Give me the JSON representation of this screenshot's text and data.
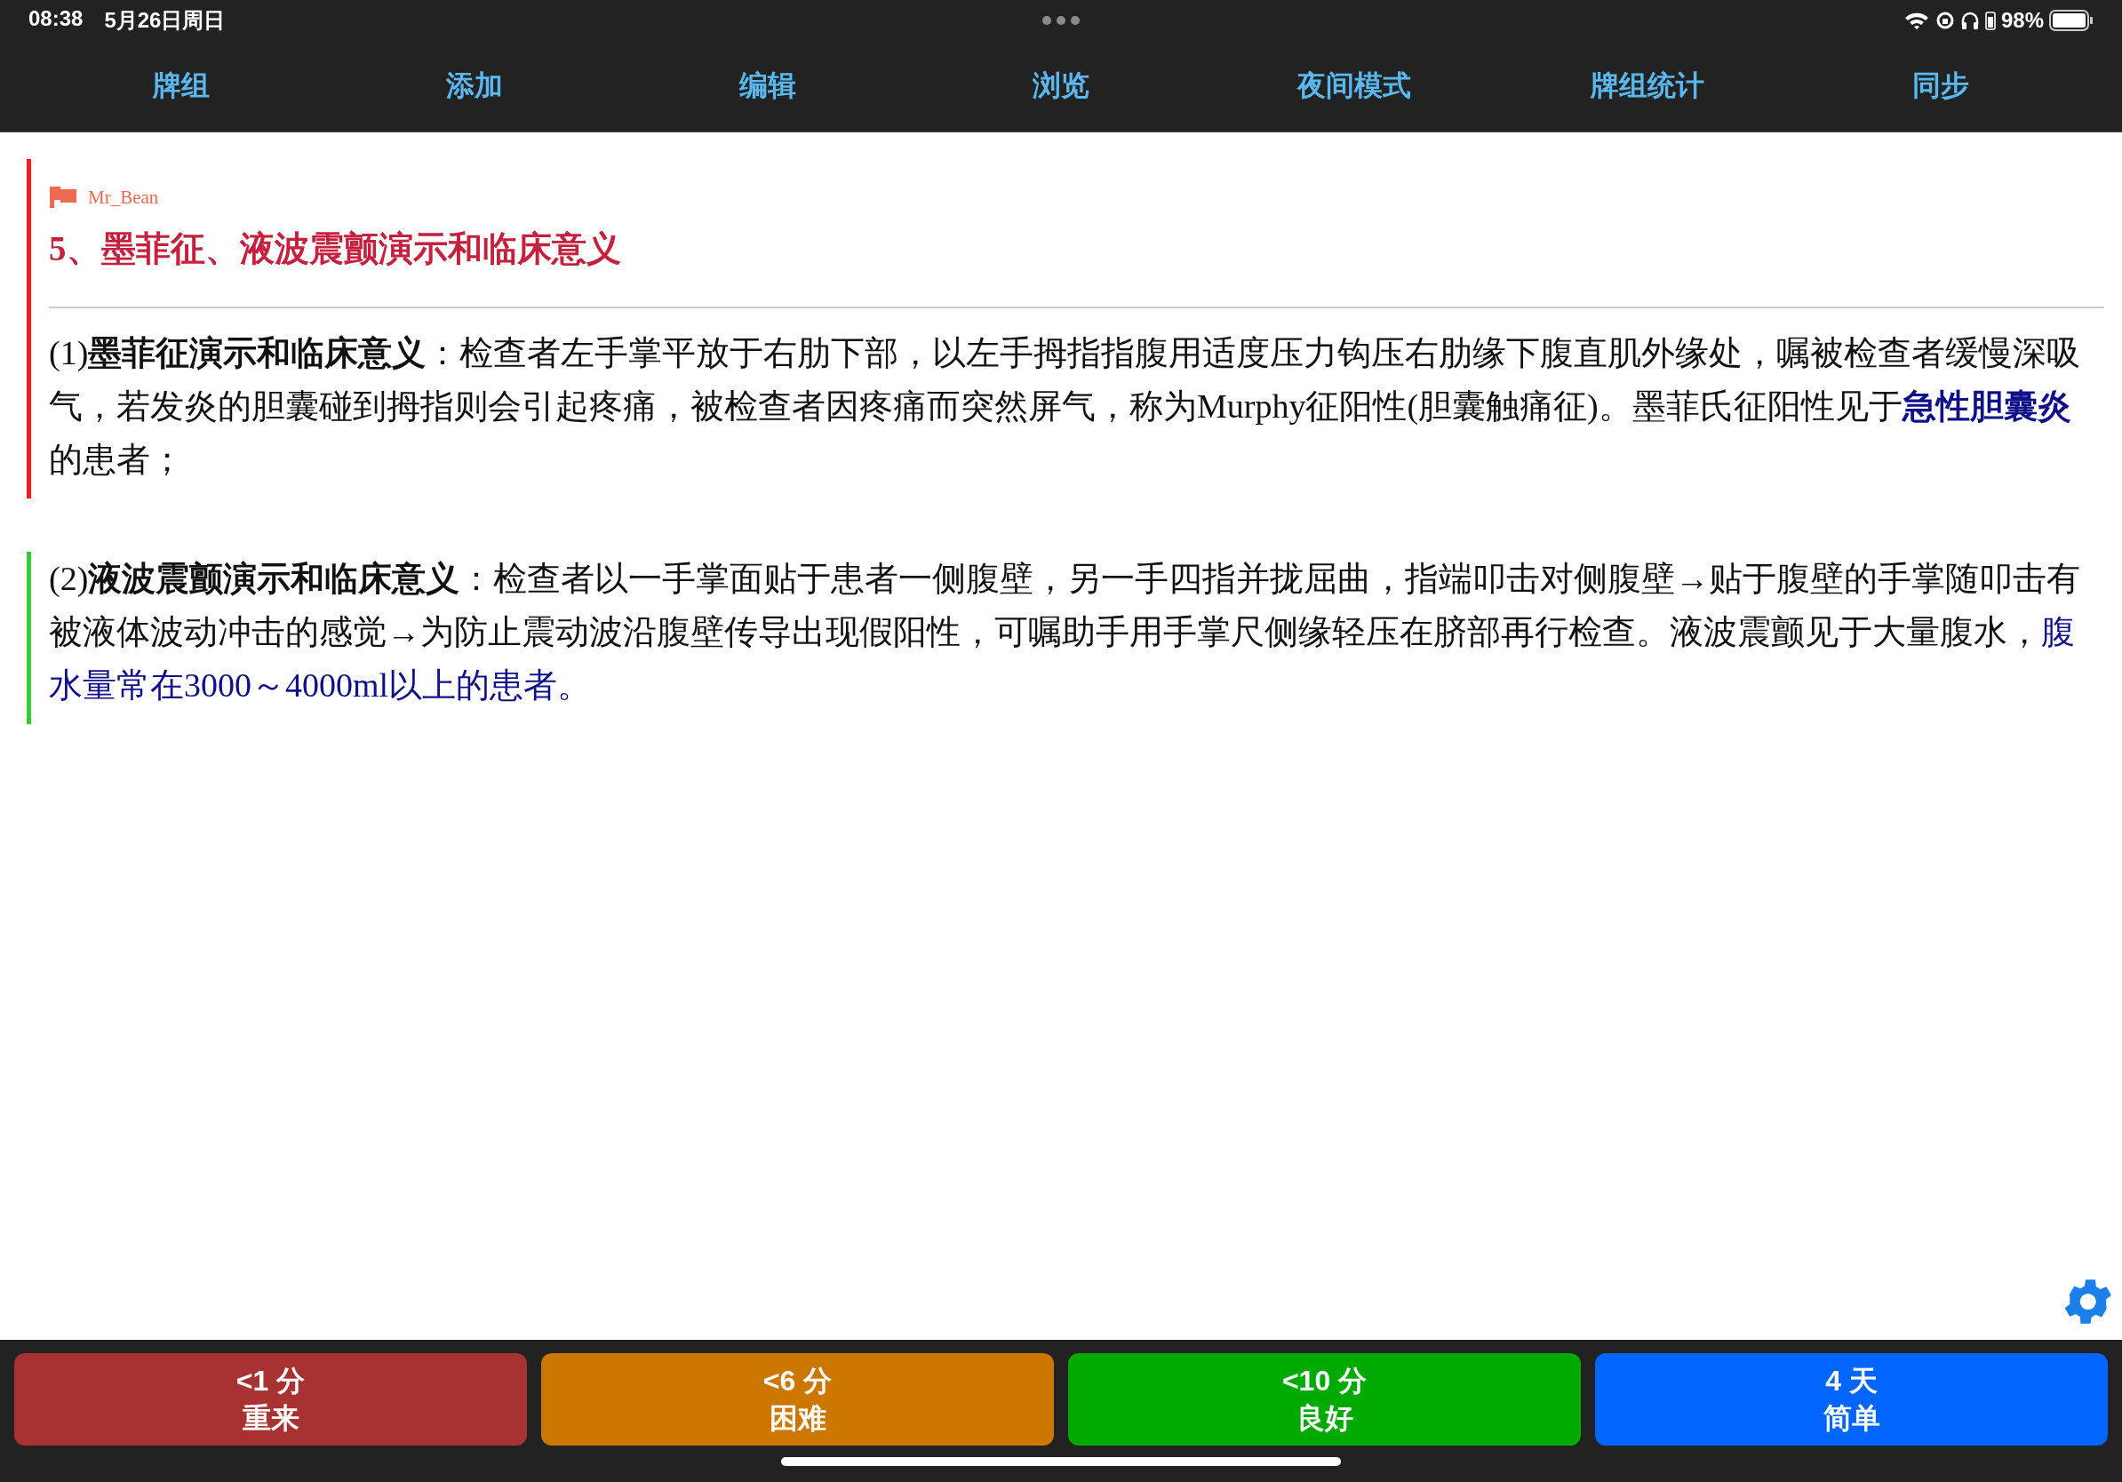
{
  "status_bar": {
    "time": "08:38",
    "date": "5月26日周日",
    "battery": "98%"
  },
  "nav_tabs": [
    "牌组",
    "添加",
    "编辑",
    "浏览",
    "夜间模式",
    "牌组统计",
    "同步"
  ],
  "card": {
    "author": "Mr_Bean",
    "title": "5、墨菲征、液波震颤演示和临床意义",
    "sections": [
      {
        "color": "#ff1a1a",
        "segments": [
          {
            "kind": "plain",
            "text": "(1)"
          },
          {
            "kind": "bold",
            "text": "墨菲征演示和临床意义"
          },
          {
            "kind": "plain",
            "text": "：检查者左手掌平放于右肋下部，以左手拇指指腹用适度压力钩压右肋缘下腹直肌外缘处，嘱被检查者缓慢深吸气，若发炎的胆囊碰到拇指则会引起疼痛，被检查者因疼痛而突然屏气，称为Murphy征阳性(胆囊触痛征)。墨菲氏征阳性见于"
          },
          {
            "kind": "highlight-bold",
            "text": "急性胆囊炎"
          },
          {
            "kind": "plain",
            "text": "的患者；"
          }
        ]
      },
      {
        "color": "#33cc33",
        "segments": [
          {
            "kind": "plain",
            "text": "(2)"
          },
          {
            "kind": "bold",
            "text": "液波震颤演示和临床意义"
          },
          {
            "kind": "plain",
            "text": "：检查者以一手掌面贴于患者一侧腹壁，另一手四指并拢屈曲，指端叩击对侧腹壁→贴于腹壁的手掌随叩击有被液体波动冲击的感觉→为防止震动波沿腹壁传导出现假阳性，可嘱助手用手掌尺侧缘轻压在脐部再行检查。液波震颤见于大量腹水，"
          },
          {
            "kind": "highlight",
            "text": "腹水量常在3000～4000ml以上的患者。"
          }
        ]
      }
    ]
  },
  "answer_buttons": [
    {
      "interval": "<1 分",
      "label": "重来",
      "color": "#a83232"
    },
    {
      "interval": "<6 分",
      "label": "困难",
      "color": "#cc7700"
    },
    {
      "interval": "<10 分",
      "label": "良好",
      "color": "#00aa00"
    },
    {
      "interval": "4 天",
      "label": "简单",
      "color": "#0066ff"
    }
  ]
}
